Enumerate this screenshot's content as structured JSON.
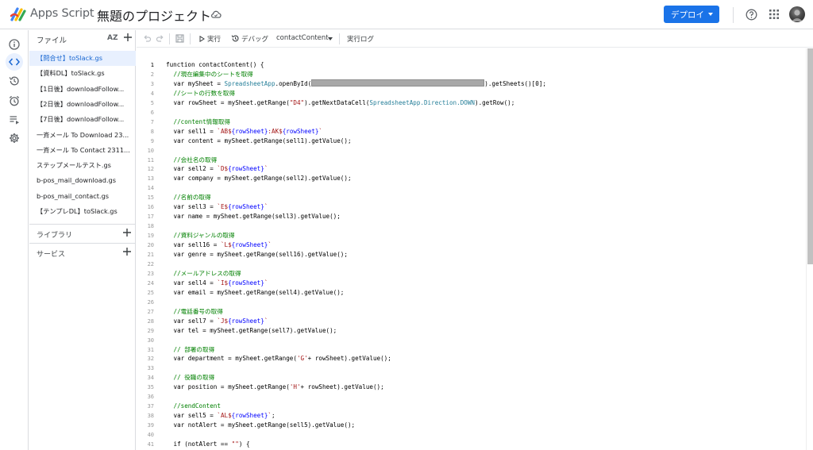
{
  "header": {
    "app_name": "Apps Script",
    "project_title": "無題のプロジェクト",
    "deploy_label": "デプロイ"
  },
  "rail": {
    "icons": [
      "info-icon",
      "code-icon",
      "history-icon",
      "alarm-icon",
      "executions-icon",
      "settings-icon"
    ]
  },
  "files": {
    "label": "ファイル",
    "sort_label": "AZ",
    "items": [
      "【問合せ】toSlack.gs",
      "【資料DL】toSlack.gs",
      "【1日後】downloadFollow...",
      "【2日後】downloadFollow...",
      "【7日後】downloadFollow...",
      "一斉メール To Download 23...",
      "一斉メール To Contact 2311...",
      "ステップメールテスト.gs",
      "b-pos_mail_download.gs",
      "b-pos_mail_contact.gs",
      "【テンプレDL】toSlack.gs"
    ],
    "active_index": 0
  },
  "sections": {
    "libraries": "ライブラリ",
    "services": "サービス"
  },
  "toolbar": {
    "run_label": "実行",
    "debug_label": "デバッグ",
    "function_name": "contactContent",
    "log_label": "実行ログ"
  },
  "editor": {
    "current_line": 1,
    "lines": [
      [
        {
          "t": "function contactContent() {"
        }
      ],
      [
        {
          "i": 1
        },
        {
          "t": "//現在編集中のシートを取得",
          "c": "com"
        }
      ],
      [
        {
          "i": 1
        },
        {
          "t": "var mySheet = "
        },
        {
          "t": "SpreadsheetApp",
          "c": "cls"
        },
        {
          "t": ".openById("
        },
        {
          "redact": true
        },
        {
          "t": ").getSheets()[0];"
        }
      ],
      [
        {
          "i": 1
        },
        {
          "t": "//シートの行数を取得",
          "c": "com"
        }
      ],
      [
        {
          "i": 1
        },
        {
          "t": "var rowSheet = mySheet.getRange("
        },
        {
          "t": "\"D4\"",
          "c": "str"
        },
        {
          "t": ").getNextDataCell("
        },
        {
          "t": "SpreadsheetApp.Direction.DOWN",
          "c": "cls"
        },
        {
          "t": ").getRow();"
        }
      ],
      [],
      [
        {
          "i": 1
        },
        {
          "t": "//content情報取得",
          "c": "com"
        }
      ],
      [
        {
          "i": 1
        },
        {
          "t": "var sell1 = "
        },
        {
          "t": "`AB$",
          "c": "str"
        },
        {
          "t": "{rowSheet}",
          "c": "tv"
        },
        {
          "t": ":AK$",
          "c": "str"
        },
        {
          "t": "{rowSheet}",
          "c": "tv"
        },
        {
          "t": "`",
          "c": "str"
        }
      ],
      [
        {
          "i": 1
        },
        {
          "t": "var content = mySheet.getRange(sell1).getValue();"
        }
      ],
      [],
      [
        {
          "i": 1
        },
        {
          "t": "//会社名の取得",
          "c": "com"
        }
      ],
      [
        {
          "i": 1
        },
        {
          "t": "var sell2 = "
        },
        {
          "t": "`D$",
          "c": "str"
        },
        {
          "t": "{rowSheet}",
          "c": "tv"
        },
        {
          "t": "`",
          "c": "str"
        }
      ],
      [
        {
          "i": 1
        },
        {
          "t": "var company = mySheet.getRange(sell2).getValue();"
        }
      ],
      [],
      [
        {
          "i": 1
        },
        {
          "t": "//名前の取得",
          "c": "com"
        }
      ],
      [
        {
          "i": 1
        },
        {
          "t": "var sell3 = "
        },
        {
          "t": "`E$",
          "c": "str"
        },
        {
          "t": "{rowSheet}",
          "c": "tv"
        },
        {
          "t": "`",
          "c": "str"
        }
      ],
      [
        {
          "i": 1
        },
        {
          "t": "var name = mySheet.getRange(sell3).getValue();"
        }
      ],
      [],
      [
        {
          "i": 1
        },
        {
          "t": "//資料ジャンルの取得",
          "c": "com"
        }
      ],
      [
        {
          "i": 1
        },
        {
          "t": "var sell16 = "
        },
        {
          "t": "`L$",
          "c": "str"
        },
        {
          "t": "{rowSheet}",
          "c": "tv"
        },
        {
          "t": "`",
          "c": "str"
        }
      ],
      [
        {
          "i": 1
        },
        {
          "t": "var genre = mySheet.getRange(sell16).getValue();"
        }
      ],
      [],
      [
        {
          "i": 1
        },
        {
          "t": "//メールアドレスの取得",
          "c": "com"
        }
      ],
      [
        {
          "i": 1
        },
        {
          "t": "var sell4 = "
        },
        {
          "t": "`I$",
          "c": "str"
        },
        {
          "t": "{rowSheet}",
          "c": "tv"
        },
        {
          "t": "`",
          "c": "str"
        }
      ],
      [
        {
          "i": 1
        },
        {
          "t": "var email = mySheet.getRange(sell4).getValue();"
        }
      ],
      [],
      [
        {
          "i": 1
        },
        {
          "t": "//電話番号の取得",
          "c": "com"
        }
      ],
      [
        {
          "i": 1
        },
        {
          "t": "var sell7 = "
        },
        {
          "t": "`J$",
          "c": "str"
        },
        {
          "t": "{rowSheet}",
          "c": "tv"
        },
        {
          "t": "`",
          "c": "str"
        }
      ],
      [
        {
          "i": 1
        },
        {
          "t": "var tel = mySheet.getRange(sell7).getValue();"
        }
      ],
      [],
      [
        {
          "i": 1
        },
        {
          "t": "// 部署の取得",
          "c": "com"
        }
      ],
      [
        {
          "i": 1
        },
        {
          "t": "var department = mySheet.getRange("
        },
        {
          "t": "'G'",
          "c": "str"
        },
        {
          "t": "+ rowSheet).getValue();"
        }
      ],
      [],
      [
        {
          "i": 1
        },
        {
          "t": "// 役職の取得",
          "c": "com"
        }
      ],
      [
        {
          "i": 1
        },
        {
          "t": "var position = mySheet.getRange("
        },
        {
          "t": "'H'",
          "c": "str"
        },
        {
          "t": "+ rowSheet).getValue();"
        }
      ],
      [],
      [
        {
          "i": 1
        },
        {
          "t": "//sendContent",
          "c": "com"
        }
      ],
      [
        {
          "i": 1
        },
        {
          "t": "var sell5 = "
        },
        {
          "t": "`AL$",
          "c": "str"
        },
        {
          "t": "{rowSheet}",
          "c": "tv"
        },
        {
          "t": "`",
          "c": "str"
        },
        {
          "t": ";"
        }
      ],
      [
        {
          "i": 1
        },
        {
          "t": "var notAlert = mySheet.getRange(sell5).getValue();"
        }
      ],
      [],
      [
        {
          "i": 1
        },
        {
          "t": "if (notAlert == "
        },
        {
          "t": "\"\"",
          "c": "str"
        },
        {
          "t": ") {"
        }
      ]
    ]
  },
  "colors": {
    "accent": "#1a73e8",
    "active_bg": "#e8f0fe",
    "comment": "#008000",
    "string": "#a31515",
    "class": "#267f99"
  }
}
